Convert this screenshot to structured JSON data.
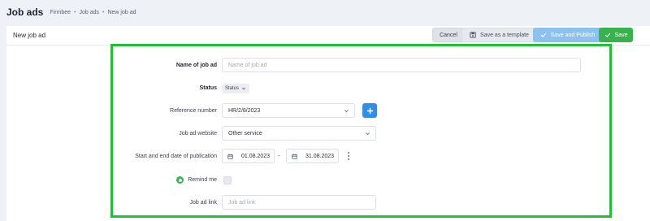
{
  "header": {
    "title": "Job ads",
    "breadcrumb": [
      "Firmbee",
      "Job ads",
      "New job ad"
    ],
    "breadcrumb_sep": "•"
  },
  "card": {
    "title": "New job ad"
  },
  "toolbar": {
    "cancel_label": "Cancel",
    "template_label": "Save as a template",
    "publish_label": "Save and Publish",
    "save_label": "Save"
  },
  "form": {
    "name": {
      "label": "Name of job ad",
      "placeholder": "Name of job ad",
      "value": ""
    },
    "status": {
      "label": "Status",
      "value": "Status"
    },
    "reference": {
      "label": "Reference number",
      "value": "HR/2/8/2023"
    },
    "website": {
      "label": "Job ad website",
      "value": "Other service"
    },
    "dates": {
      "label": "Start and end date of publication",
      "start": "01.08.2023",
      "separator": "-",
      "end": "31.08.2023"
    },
    "remind": {
      "label": "Remind me",
      "checked": false
    },
    "link": {
      "label": "Job ad link",
      "placeholder": "Job ad link",
      "value": ""
    }
  },
  "colors": {
    "accent_green": "#37b24d",
    "highlight_frame": "#1fc233",
    "primary_blue": "#2f8fe8",
    "publish_blue": "#8cc2f0"
  }
}
